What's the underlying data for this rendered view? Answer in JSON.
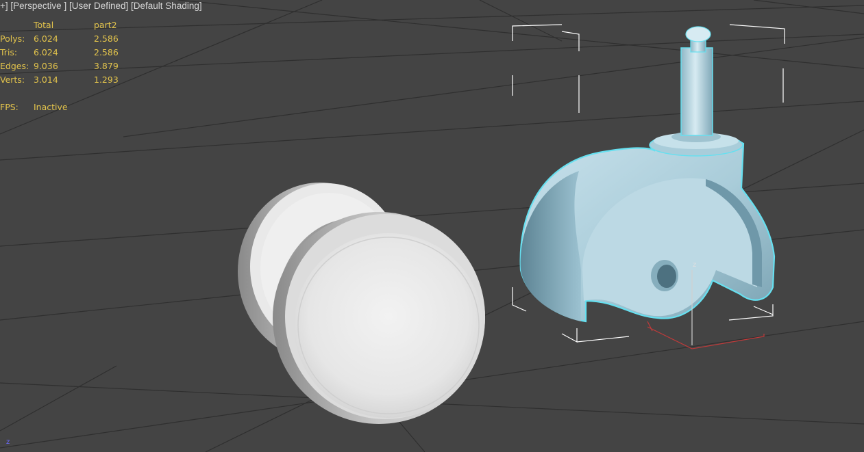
{
  "viewport": {
    "labels": [
      "+",
      "Perspective",
      "User Defined",
      "Default Shading"
    ],
    "label_colors": {
      "text": "#d6d6d6",
      "hud": "#e3c44c",
      "background": "#444444",
      "selection": "#66e0f0"
    }
  },
  "stats": {
    "header_total": "Total",
    "header_object": "part2",
    "rows": [
      {
        "label": "Polys:",
        "total": "6.024",
        "object": "2.586"
      },
      {
        "label": "Tris:",
        "total": "6.024",
        "object": "2.586"
      },
      {
        "label": "Edges:",
        "total": "9.036",
        "object": "3.879"
      },
      {
        "label": "Verts:",
        "total": "3.014",
        "object": "1.293"
      }
    ],
    "fps_label": "FPS:",
    "fps_value": "Inactive"
  },
  "gizmo": {
    "z_label": "z",
    "corner_axis_label": "z"
  },
  "scene": {
    "objects": [
      "wheel",
      "caster-housing"
    ],
    "selected": "caster-housing"
  }
}
